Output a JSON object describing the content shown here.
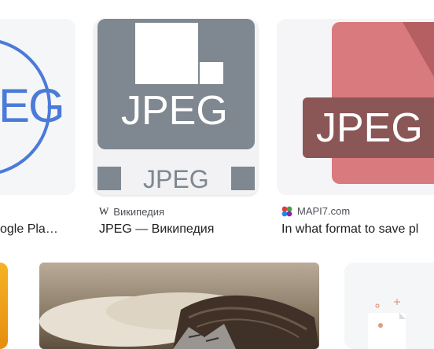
{
  "results": [
    {
      "title": "ogle Pla…",
      "logo_text": "EG",
      "ring_color": "#4a7bd8"
    },
    {
      "source": "Википедия",
      "source_icon_text": "W",
      "title": "JPEG — Википедия",
      "thumb_text": "JPEG",
      "thumb_bottom_text": "JPEG",
      "color": "#7f8890"
    },
    {
      "source": "MAPI7.com",
      "title": "In what format to save pl",
      "banner_text": "JPEG",
      "doc_color": "#d97a7e",
      "banner_color": "#8a5656"
    }
  ]
}
